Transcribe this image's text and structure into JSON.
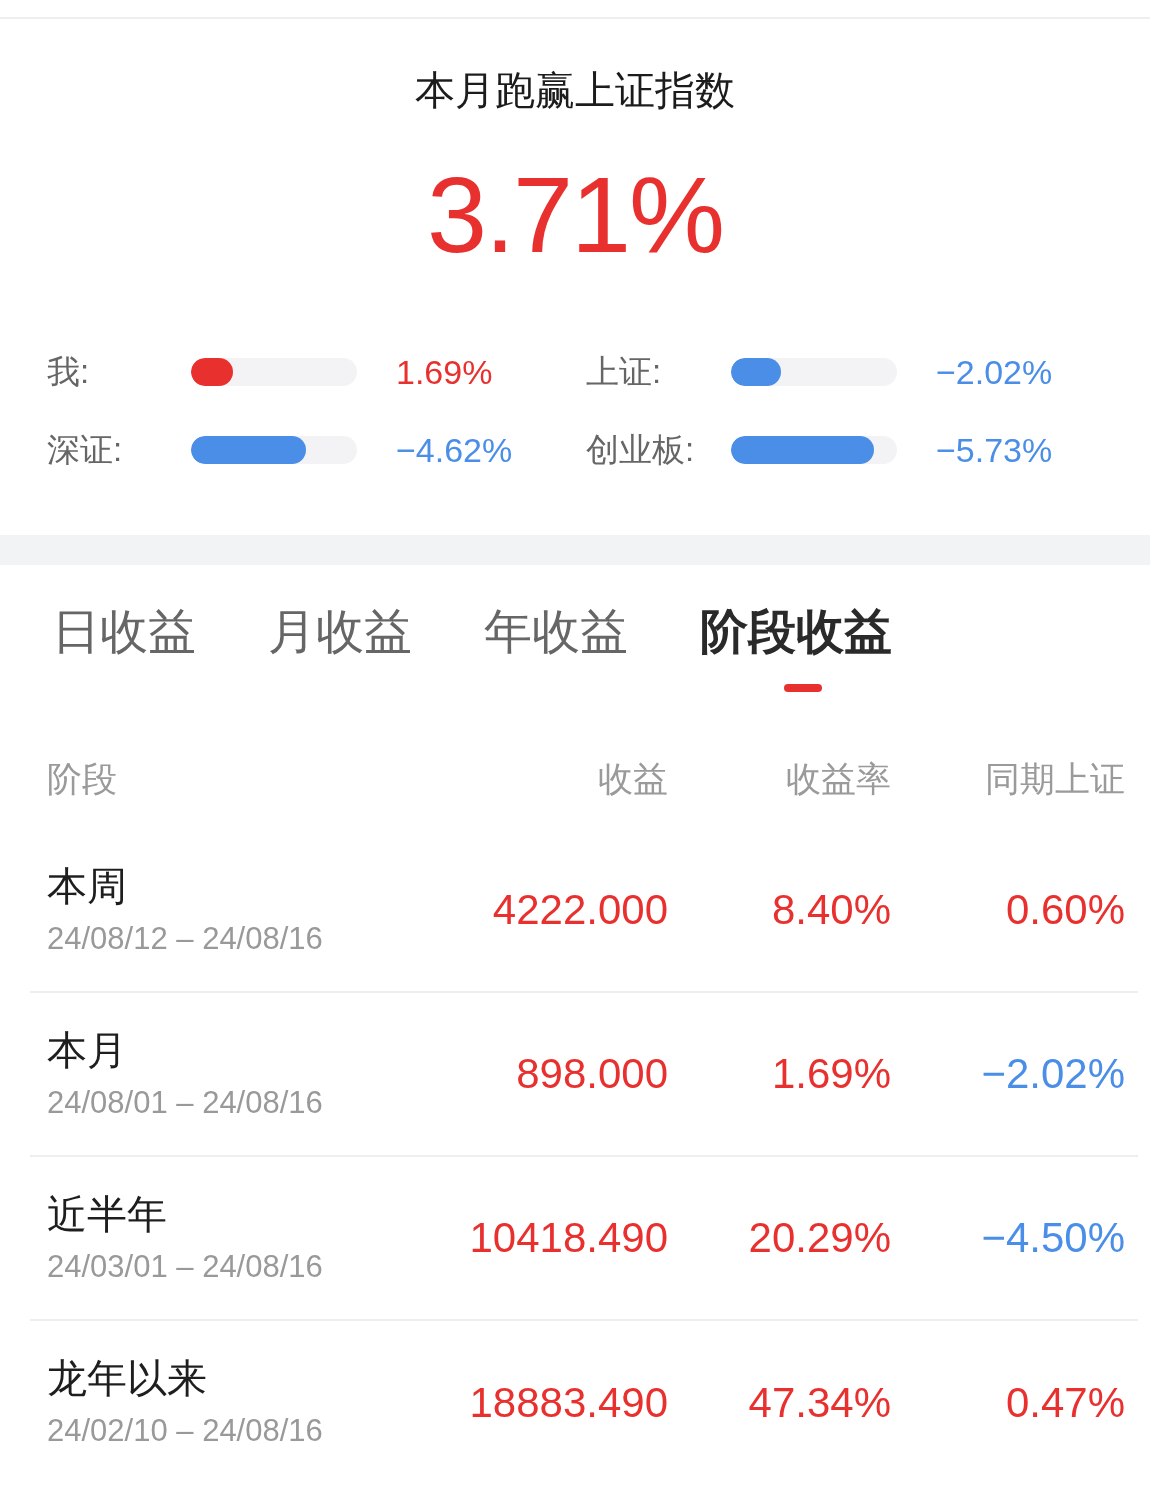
{
  "summary": {
    "title": "本月跑赢上证指数",
    "value": "3.71%"
  },
  "comparisons": [
    {
      "label": "我:",
      "level": 0.25,
      "value": "1.69%",
      "color": "#e8312f"
    },
    {
      "label": "上证:",
      "level": 0.3,
      "value": "−2.02%",
      "color": "#4a8ee8"
    },
    {
      "label": "深证:",
      "level": 0.69,
      "value": "−4.62%",
      "color": "#4a8ee8"
    },
    {
      "label": "创业板:",
      "level": 0.86,
      "value": "−5.73%",
      "color": "#4a8ee8"
    }
  ],
  "tabs": [
    {
      "label": "日收益",
      "selected": false
    },
    {
      "label": "月收益",
      "selected": false
    },
    {
      "label": "年收益",
      "selected": false
    },
    {
      "label": "阶段收益",
      "selected": true
    }
  ],
  "table": {
    "columns": [
      "阶段",
      "收益",
      "收益率",
      "同期上证"
    ],
    "rows": [
      {
        "cells": [
          {
            "kind": "period",
            "text": "本周",
            "dates": "24/08/12 – 24/08/16"
          },
          {
            "kind": "value",
            "text": "4222.000",
            "color": "#e8312f"
          },
          {
            "kind": "value",
            "text": "8.40%",
            "color": "#e8312f"
          },
          {
            "kind": "value",
            "text": "0.60%",
            "color": "#e8312f"
          }
        ]
      },
      {
        "cells": [
          {
            "kind": "period",
            "text": "本月",
            "dates": "24/08/01 – 24/08/16"
          },
          {
            "kind": "value",
            "text": "898.000",
            "color": "#e8312f"
          },
          {
            "kind": "value",
            "text": "1.69%",
            "color": "#e8312f"
          },
          {
            "kind": "value",
            "text": "−2.02%",
            "color": "#4a8ee8"
          }
        ]
      },
      {
        "cells": [
          {
            "kind": "period",
            "text": "近半年",
            "dates": "24/03/01 – 24/08/16"
          },
          {
            "kind": "value",
            "text": "10418.490",
            "color": "#e8312f"
          },
          {
            "kind": "value",
            "text": "20.29%",
            "color": "#e8312f"
          },
          {
            "kind": "value",
            "text": "−4.50%",
            "color": "#4a8ee8"
          }
        ]
      },
      {
        "cells": [
          {
            "kind": "period",
            "text": "龙年以来",
            "dates": "24/02/10 – 24/08/16"
          },
          {
            "kind": "value",
            "text": "18883.490",
            "color": "#e8312f"
          },
          {
            "kind": "value",
            "text": "47.34%",
            "color": "#e8312f"
          },
          {
            "kind": "value",
            "text": "0.47%",
            "color": "#e8312f"
          }
        ]
      }
    ]
  }
}
